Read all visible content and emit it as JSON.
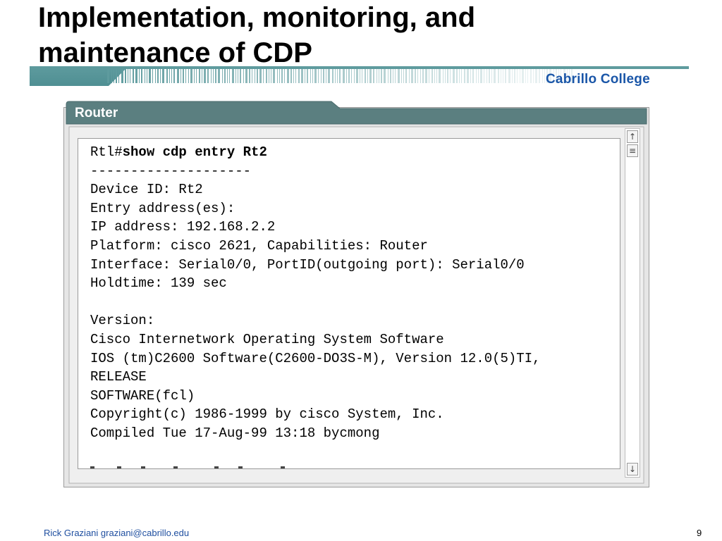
{
  "slide": {
    "title_line1": "Implementation, monitoring, and",
    "title_line2": "maintenance of CDP",
    "brand": "Cabrillo College"
  },
  "router_window": {
    "title": "Router",
    "prompt": "Rtl#",
    "command": "show cdp entry Rt2",
    "output_lines": [
      "--------------------",
      "Device ID: Rt2",
      "Entry address(es):",
      "IP address: 192.168.2.2",
      "Platform: cisco 2621, Capabilities: Router",
      "Interface: Serial0/0, PortID(outgoing port): Serial0/0",
      "Holdtime: 139 sec",
      "",
      "Version:",
      "Cisco Internetwork Operating System Software",
      "IOS (tm)C2600 Software(C2600-DO3S-M), Version 12.0(5)TI,",
      "RELEASE",
      "SOFTWARE(fcl)",
      "Copyright(c) 1986-1999 by cisco System, Inc.",
      "Compiled Tue 17-Aug-99 13:18 bycmong"
    ],
    "scrollbar": {
      "up_icon": "↑",
      "thumb_icon": "≡",
      "down_icon": "↓"
    }
  },
  "footer": {
    "author": "Rick Graziani  graziani@cabrillo.edu",
    "page_number": "9"
  },
  "colors": {
    "band": "#5e9b9e",
    "window_frame": "#5b7f80",
    "brand": "#1a56a8",
    "footer_author": "#1f4fa0"
  }
}
